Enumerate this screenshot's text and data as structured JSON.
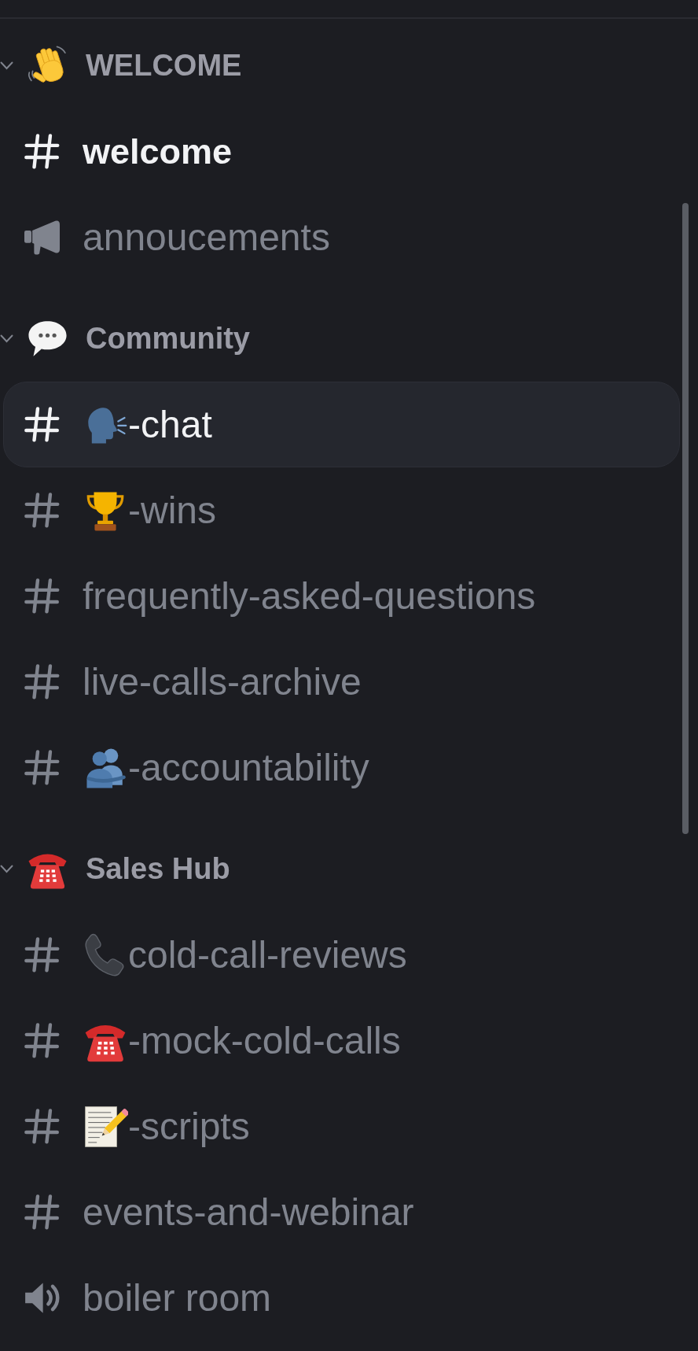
{
  "categories": [
    {
      "name": "WELCOME",
      "emoji": {
        "kind": "waving-hand"
      },
      "expanded": true,
      "channels": [
        {
          "kind": "text",
          "name": "welcome",
          "selected": false,
          "unread": true
        },
        {
          "kind": "announcement",
          "name": "annoucements",
          "selected": false,
          "unread": false
        }
      ]
    },
    {
      "name": "Community",
      "emoji": {
        "kind": "speech-bubble"
      },
      "expanded": true,
      "channels": [
        {
          "kind": "text",
          "emoji": {
            "kind": "speaking-head"
          },
          "name": "-chat",
          "selected": true,
          "unread": false
        },
        {
          "kind": "text",
          "emoji": {
            "kind": "trophy"
          },
          "name": "-wins",
          "selected": false,
          "unread": false
        },
        {
          "kind": "text",
          "name": "frequently-asked-questions",
          "selected": false,
          "unread": false
        },
        {
          "kind": "text",
          "name": "live-calls-archive",
          "selected": false,
          "unread": false
        },
        {
          "kind": "text",
          "emoji": {
            "kind": "people-hugging"
          },
          "name": "-accountability",
          "selected": false,
          "unread": false
        }
      ]
    },
    {
      "name": "Sales Hub",
      "emoji": {
        "kind": "telephone"
      },
      "expanded": true,
      "channels": [
        {
          "kind": "text",
          "emoji": {
            "kind": "phone-receiver"
          },
          "name": "cold-call-reviews",
          "selected": false,
          "unread": false
        },
        {
          "kind": "text",
          "emoji": {
            "kind": "telephone"
          },
          "name": "-mock-cold-calls",
          "selected": false,
          "unread": false
        },
        {
          "kind": "text",
          "emoji": {
            "kind": "memo"
          },
          "name": "-scripts",
          "selected": false,
          "unread": false
        },
        {
          "kind": "text",
          "name": "events-and-webinar",
          "selected": false,
          "unread": false
        },
        {
          "kind": "voice",
          "name": "boiler room",
          "selected": false,
          "unread": false
        }
      ]
    }
  ]
}
